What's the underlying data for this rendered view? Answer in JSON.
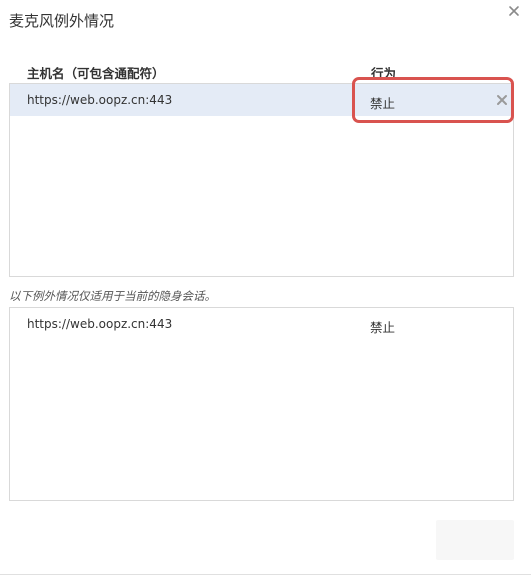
{
  "dialog": {
    "title": "麦克风例外情况",
    "close_icon": "close-icon"
  },
  "columns": {
    "host_header": "主机名（可包含通配符）",
    "behavior_header": "行为"
  },
  "exceptions": [
    {
      "host": "https://web.oopz.cn:443",
      "behavior": "禁止",
      "selected": true
    }
  ],
  "incognito": {
    "note": "以下例外情况仅适用于当前的隐身会话。",
    "exceptions": [
      {
        "host": "https://web.oopz.cn:443",
        "behavior": "禁止"
      }
    ]
  },
  "colors": {
    "selected_row": "#e4ebf6",
    "highlight_border": "#d9534f"
  }
}
